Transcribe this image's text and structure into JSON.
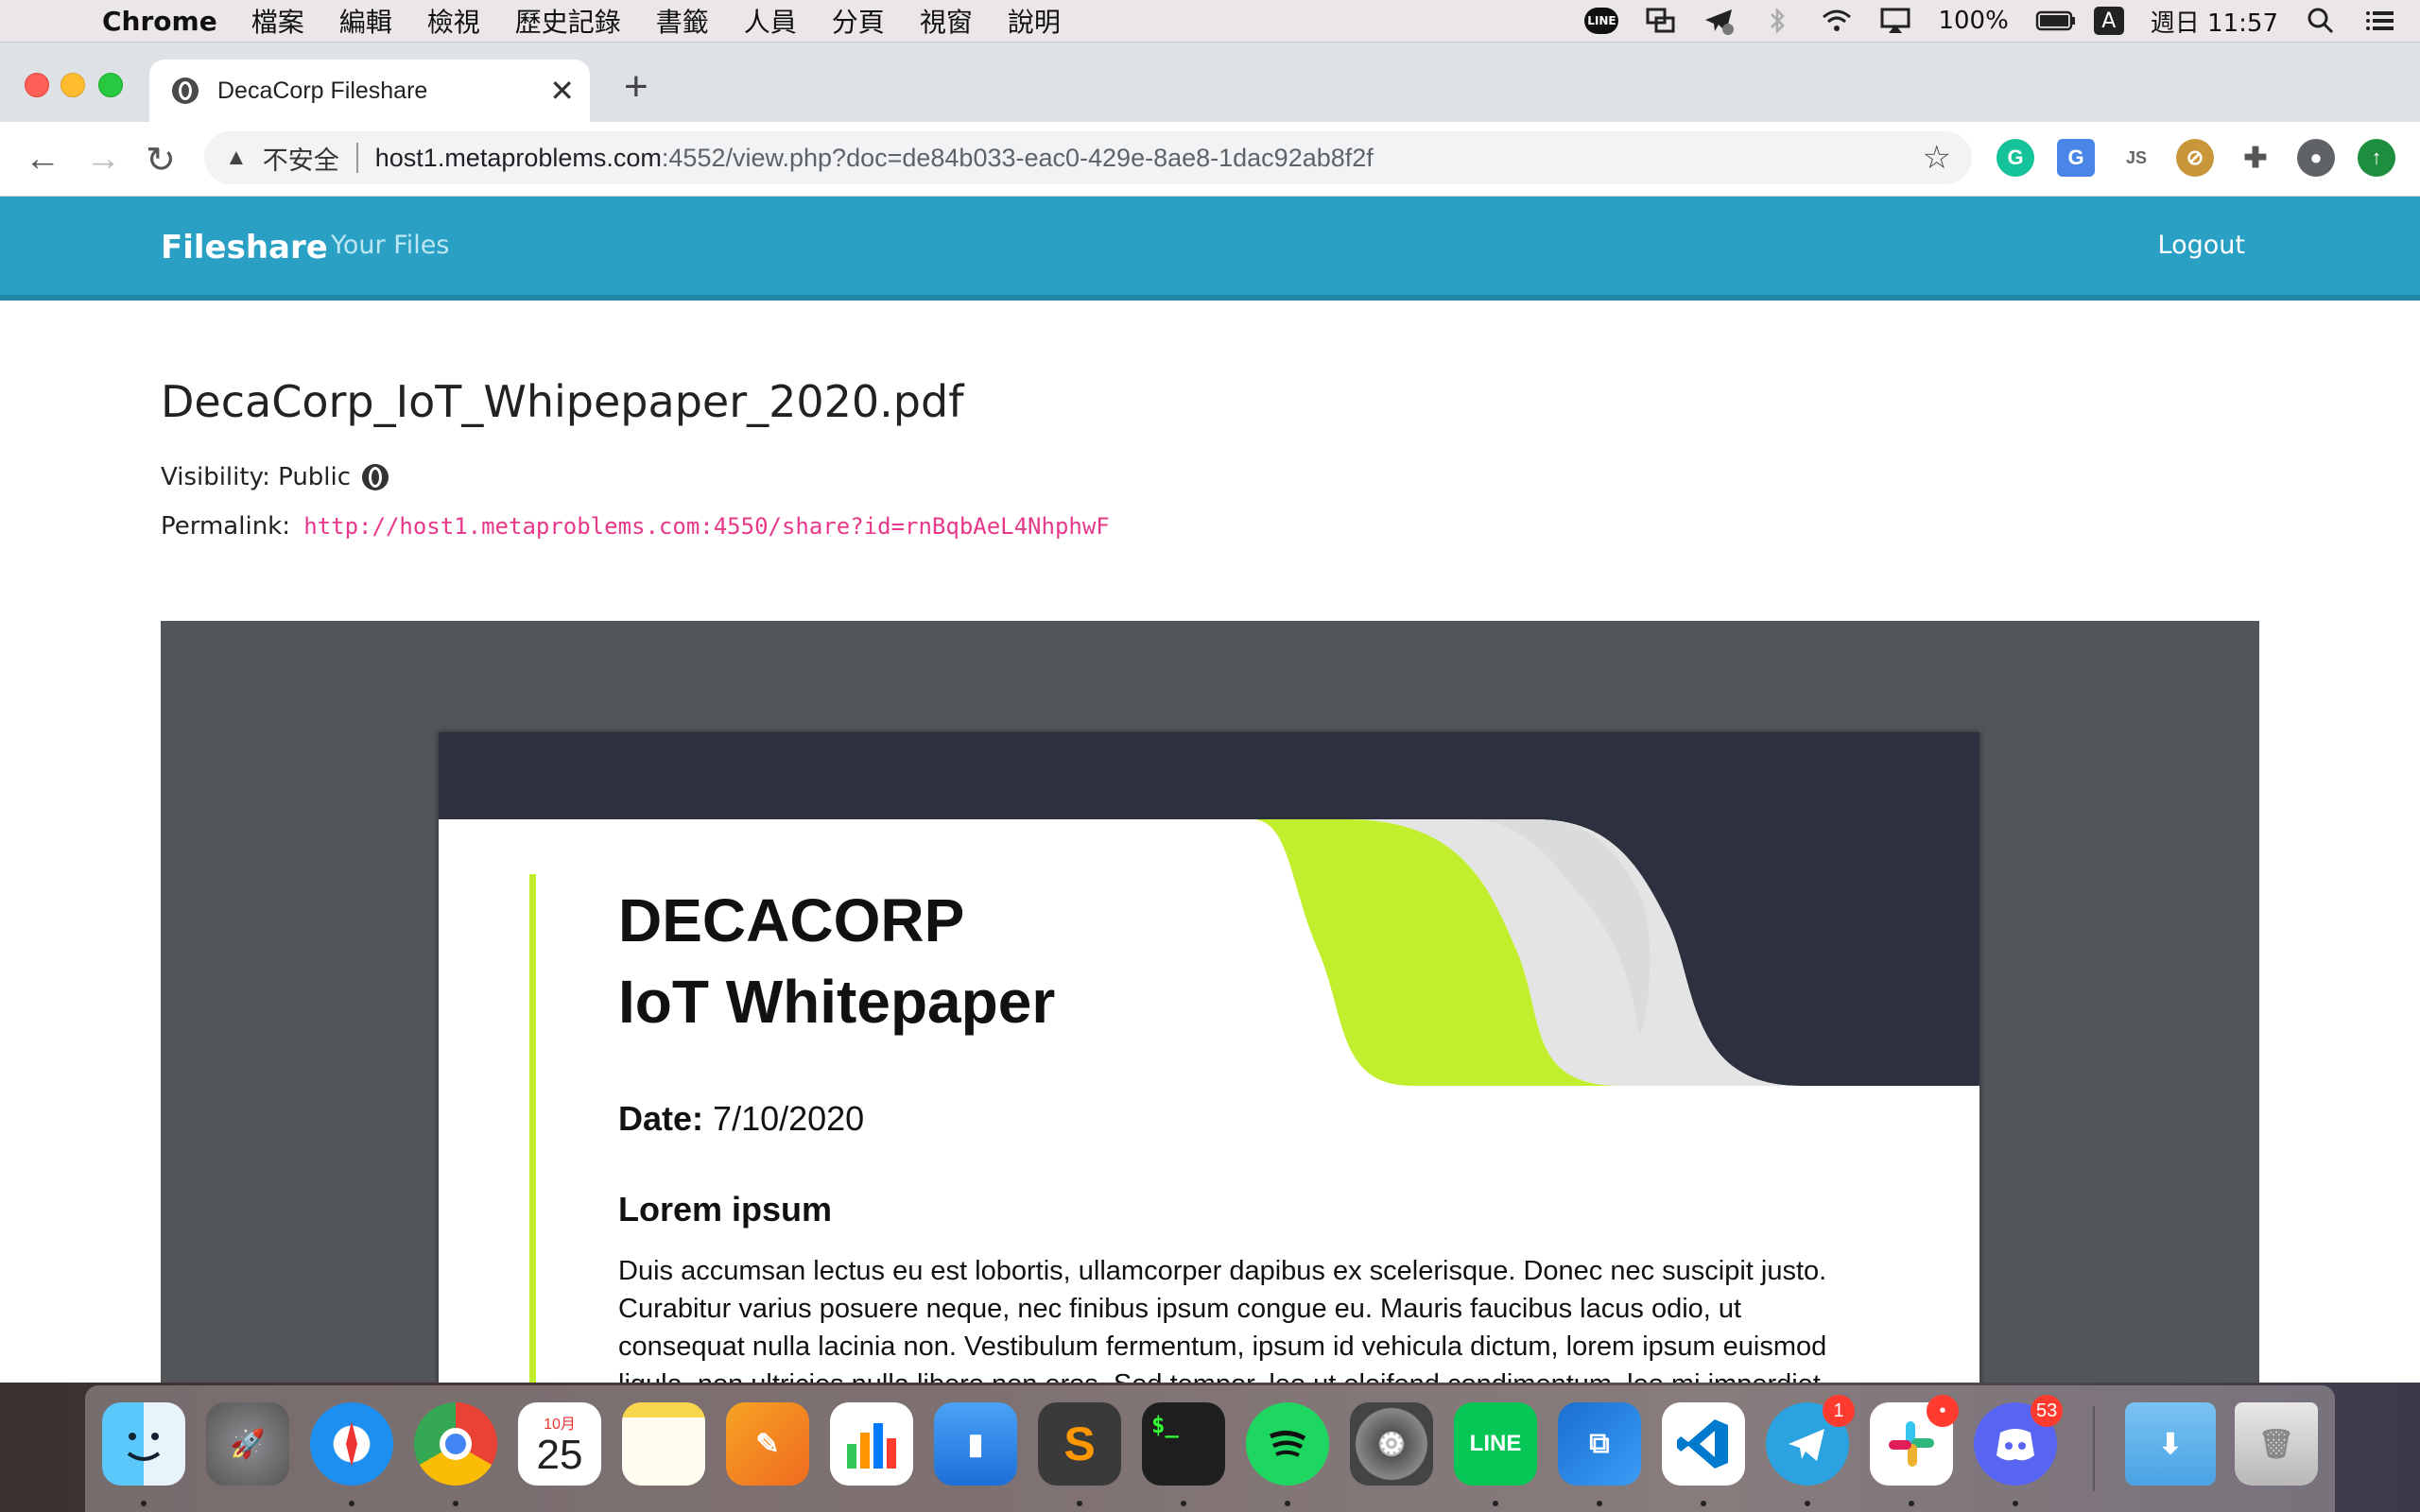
{
  "menubar": {
    "app_name": "Chrome",
    "items": [
      "檔案",
      "編輯",
      "檢視",
      "歷史記錄",
      "書籤",
      "人員",
      "分頁",
      "視窗",
      "說明"
    ],
    "battery": "100%",
    "input_source": "A",
    "clock": "週日 11:57",
    "line_label": "LINE",
    "status_icons": [
      "line-icon",
      "screen-share-icon",
      "telegram-status-icon",
      "bluetooth-icon",
      "wifi-icon",
      "airplay-icon",
      "battery-icon",
      "spotlight-icon",
      "control-center-icon"
    ]
  },
  "browser": {
    "tab_title": "DecaCorp Fileshare",
    "insecure_label": "不安全",
    "url_host": "host1.metaproblems.com",
    "url_path": ":4552/view.php?doc=de84b033-eac0-429e-8ae8-1dac92ab8f2f",
    "extensions": [
      "grammarly-icon",
      "google-translate-icon",
      "js-icon",
      "extension-disabled-icon",
      "puzzle-icon",
      "profile-icon",
      "update-icon"
    ]
  },
  "site": {
    "brand": "Fileshare",
    "nav_your_files": "Your Files",
    "logout": "Logout",
    "colors": {
      "navbar": "#2aa0c5",
      "link": "#e8388a"
    }
  },
  "document": {
    "filename": "DecaCorp_IoT_Whipepaper_2020.pdf",
    "visibility_label": "Visibility: Public",
    "permalink_label": "Permalink:",
    "permalink_url": "http://host1.metaproblems.com:4550/share?id=rnBqbAeL4NhphwF"
  },
  "pdf": {
    "company": "DECACORP",
    "title": "IoT Whitepaper",
    "date_label": "Date:",
    "date_value": "7/10/2020",
    "heading": "Lorem ipsum",
    "body": "Duis accumsan lectus eu est lobortis, ullamcorper dapibus ex scelerisque. Donec nec suscipit justo. Curabitur varius posuere neque, nec finibus ipsum congue eu. Mauris faucibus lacus odio, ut consequat nulla lacinia non. Vestibulum fermentum, ipsum id vehicula dictum, lorem ipsum euismod ligula, non ultricies nulla libero non eros. Sed tempor, leo ut eleifend condimentum, leo mi imperdiet odio, in condimentum ante lacus eget augue.",
    "colors": {
      "dark": "#2d303f",
      "accent": "#c1ef2e",
      "gray": "#e4e4e4"
    }
  },
  "dock": {
    "calendar_month": "10月",
    "calendar_day": "25",
    "line_label": "LINE",
    "telegram_badge": "1",
    "slack_badge": "•",
    "discord_badge": "53",
    "apps": [
      "finder",
      "launchpad",
      "safari",
      "chrome",
      "calendar",
      "notes",
      "pages",
      "numbers",
      "keynote",
      "sublime-text",
      "terminal",
      "spotify",
      "system-preferences",
      "line",
      "vmware",
      "vscode",
      "telegram",
      "slack",
      "discord",
      "downloads",
      "trash"
    ]
  }
}
